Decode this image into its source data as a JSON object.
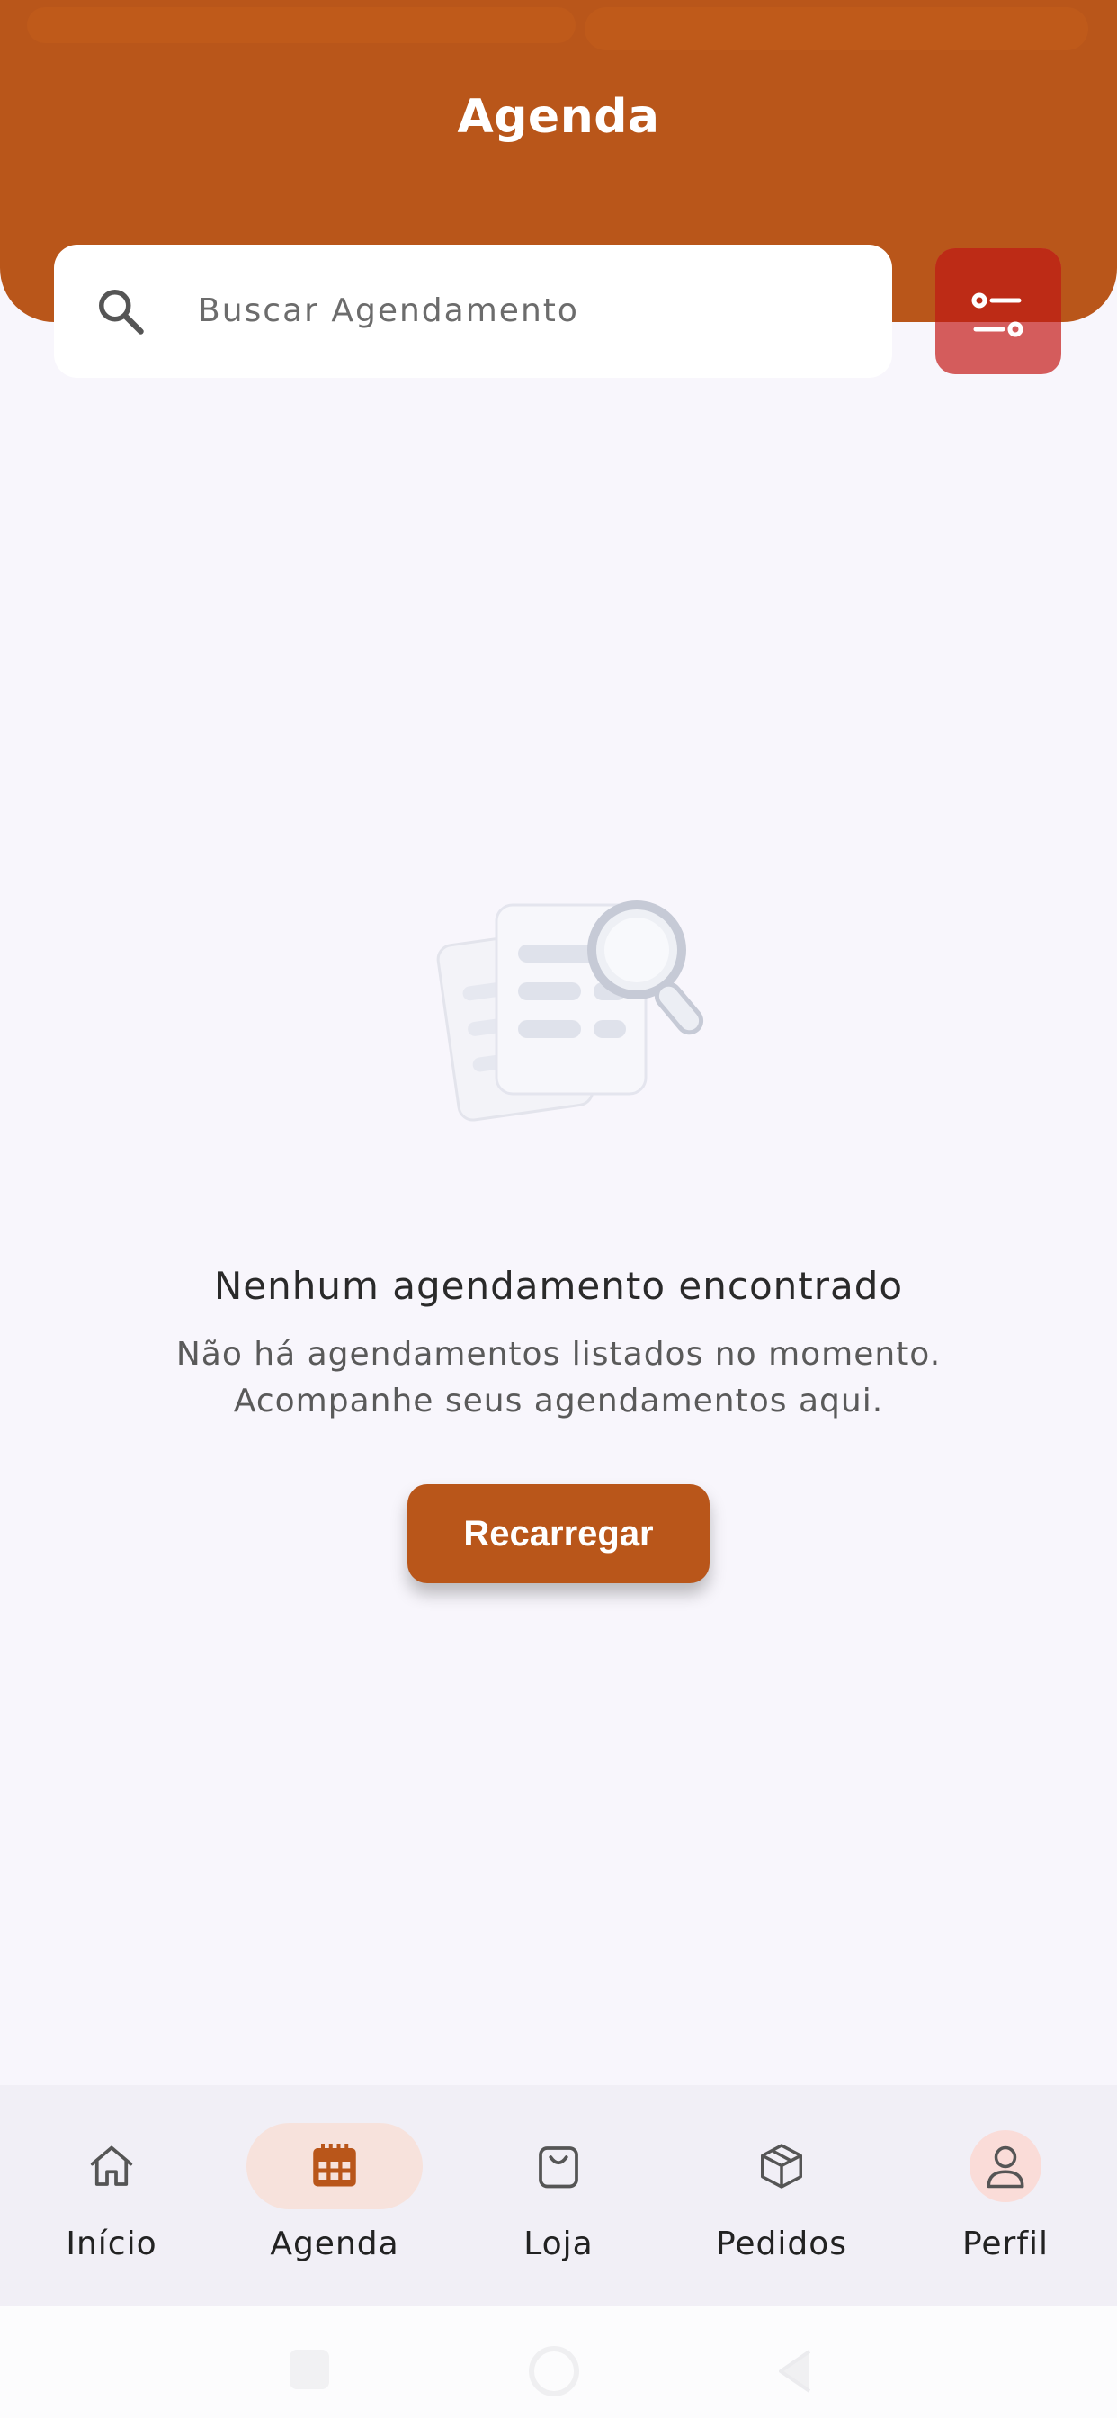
{
  "header": {
    "title": "Agenda"
  },
  "search": {
    "placeholder": "Buscar Agendamento"
  },
  "empty_state": {
    "title": "Nenhum agendamento encontrado",
    "description": "Não há agendamentos listados no momento. Acompanhe seus agendamentos aqui.",
    "reload_label": "Recarregar"
  },
  "bottom_nav": {
    "items": [
      {
        "label": "Início",
        "icon": "home-icon",
        "active": false
      },
      {
        "label": "Agenda",
        "icon": "calendar-icon",
        "active": true
      },
      {
        "label": "Loja",
        "icon": "shopping-bag-icon",
        "active": false
      },
      {
        "label": "Pedidos",
        "icon": "package-icon",
        "active": false
      },
      {
        "label": "Perfil",
        "icon": "user-icon",
        "active": false
      }
    ]
  },
  "colors": {
    "primary": "#b9561a",
    "filter_button": "#bd2b16",
    "background": "#f8f6fc",
    "nav_active_bg": "#f7e2dc"
  }
}
